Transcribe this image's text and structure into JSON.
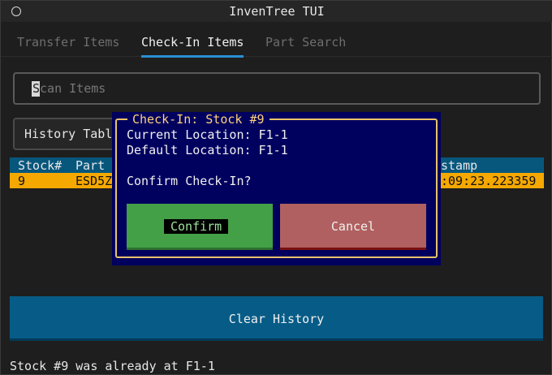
{
  "window": {
    "title": "InvenTree TUI",
    "icon": "circle-icon"
  },
  "tabs": [
    {
      "label": "Transfer Items",
      "active": false
    },
    {
      "label": "Check-In Items",
      "active": true
    },
    {
      "label": "Part Search",
      "active": false
    }
  ],
  "scan": {
    "placeholder": "Scan Items",
    "placeholder_first": "S",
    "placeholder_rest": "can Items"
  },
  "history_button": {
    "label": "History Table"
  },
  "table": {
    "columns": [
      "Stock#",
      "Part",
      "stamp"
    ],
    "rows": [
      {
        "stock": "9",
        "part": "ESD5Z",
        "timestamp": ":09:23.223359"
      }
    ]
  },
  "clear_button": {
    "label": "Clear History"
  },
  "status_text": "Stock #9 was already at F1-1",
  "dialog": {
    "title": "Check-In: Stock #9",
    "current_location": "Current Location: F1-1",
    "default_location": "Default Location: F1-1",
    "prompt": "Confirm Check-In?",
    "confirm_label": "Confirm",
    "cancel_label": "Cancel"
  },
  "colors": {
    "accent": "#2a8fd6",
    "table_header": "#07577d",
    "selected_row": "#f5a800",
    "dialog_bg": "#00005f",
    "dialog_border": "#e8c36a",
    "confirm": "#43a047",
    "cancel": "#b06060"
  }
}
